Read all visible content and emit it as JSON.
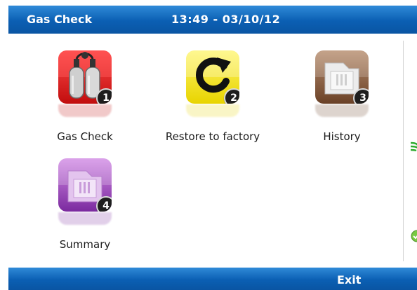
{
  "header": {
    "app_title": "Gas Check",
    "time_date": "13:49 - 03/10/12"
  },
  "menu": {
    "items": [
      {
        "label": "Gas Check",
        "number": "1",
        "icon": "gas-cylinders-icon"
      },
      {
        "label": "Restore to factory",
        "number": "2",
        "icon": "restore-arrow-icon"
      },
      {
        "label": "History",
        "number": "3",
        "icon": "history-folder-icon"
      },
      {
        "label": "Summary",
        "number": "4",
        "icon": "summary-folder-icon"
      }
    ]
  },
  "footer": {
    "exit_label": "Exit"
  },
  "colors": {
    "bar_blue": "#0b5fb3",
    "gas_red": "#c10d0d",
    "restore_yellow": "#e8d400",
    "history_brown": "#6a4127",
    "summary_purple": "#7b2a9f"
  }
}
